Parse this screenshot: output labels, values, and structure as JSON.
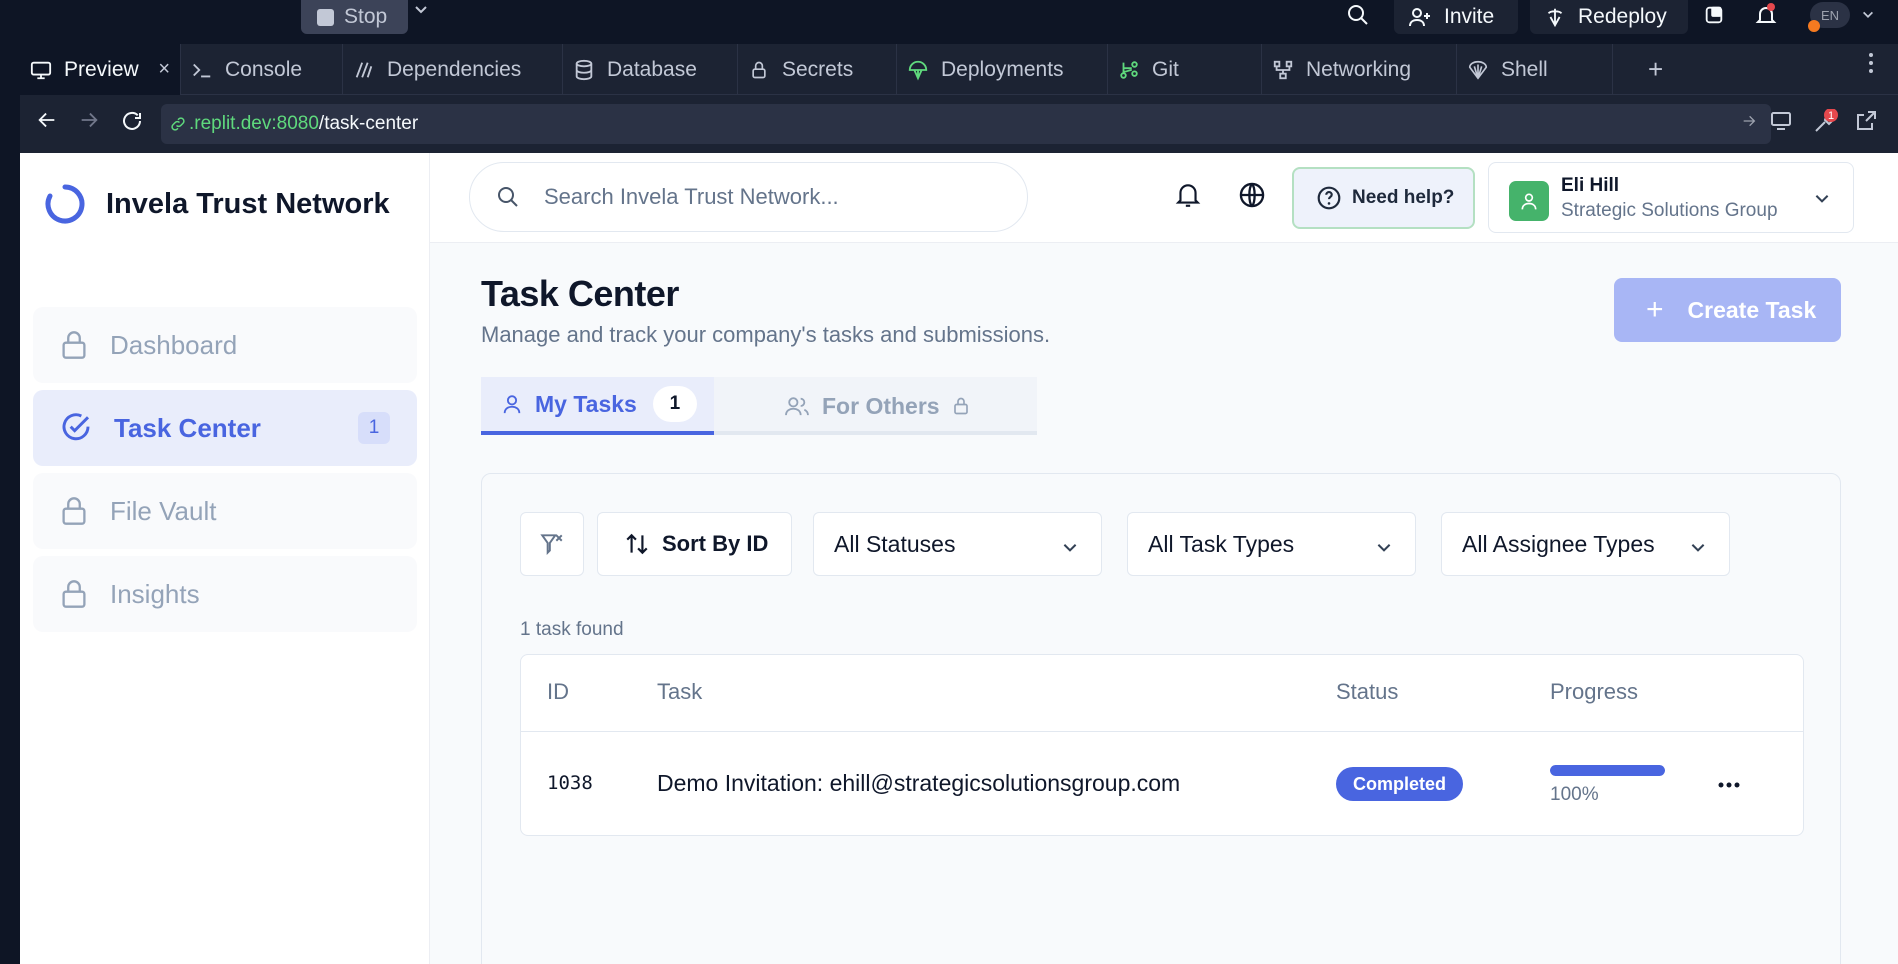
{
  "replit": {
    "stop_label": "Stop",
    "invite_label": "Invite",
    "redeploy_label": "Redeploy",
    "lang_badge": "EN",
    "notification_count": "1",
    "tabs": [
      {
        "label": "Preview",
        "icon": "monitor-icon"
      },
      {
        "label": "Console",
        "icon": "terminal-icon"
      },
      {
        "label": "Dependencies",
        "icon": "dependencies-icon"
      },
      {
        "label": "Database",
        "icon": "database-icon"
      },
      {
        "label": "Secrets",
        "icon": "lock-icon"
      },
      {
        "label": "Deployments",
        "icon": "deployments-icon"
      },
      {
        "label": "Git",
        "icon": "git-icon"
      },
      {
        "label": "Networking",
        "icon": "networking-icon"
      },
      {
        "label": "Shell",
        "icon": "shell-icon"
      }
    ],
    "url_host": ".replit.dev:8080",
    "url_path": "/task-center",
    "devtools_badge": "1"
  },
  "app": {
    "brand": "Invela Trust Network",
    "search_placeholder": "Search Invela Trust Network...",
    "help_label": "Need help?",
    "user": {
      "name": "Eli Hill",
      "org": "Strategic Solutions Group"
    },
    "nav": [
      {
        "label": "Dashboard",
        "locked": true,
        "active": false
      },
      {
        "label": "Task Center",
        "locked": false,
        "active": true,
        "badge": "1"
      },
      {
        "label": "File Vault",
        "locked": true,
        "active": false
      },
      {
        "label": "Insights",
        "locked": true,
        "active": false
      }
    ],
    "page": {
      "title": "Task Center",
      "subtitle": "Manage and track your company's tasks and submissions.",
      "create_label": "Create Task"
    },
    "tabs": {
      "my_tasks": {
        "label": "My Tasks",
        "count": "1"
      },
      "for_others": {
        "label": "For Others"
      }
    },
    "filters": {
      "sort_label": "Sort By ID",
      "status": "All Statuses",
      "task_type": "All Task Types",
      "assignee_type": "All Assignee Types"
    },
    "result_count": "1 task found",
    "table": {
      "headers": {
        "id": "ID",
        "task": "Task",
        "status": "Status",
        "progress": "Progress"
      },
      "rows": [
        {
          "id": "1038",
          "task": "Demo Invitation: ehill@strategicsolutionsgroup.com",
          "status": "Completed",
          "progress": 1.0,
          "progress_label": "100%"
        }
      ]
    },
    "colors": {
      "accent": "#4965e0",
      "create_button": "#a8b6f5",
      "avatar": "#45b36b"
    }
  }
}
